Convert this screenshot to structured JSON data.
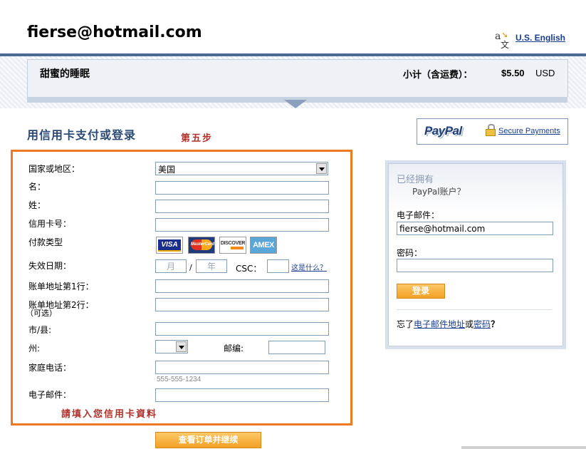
{
  "header": {
    "account_email": "fierse@hotmail.com",
    "language_icon": "translate-icon",
    "language_link": "U.S. English"
  },
  "cart": {
    "item_title": "甜蜜的睡眠",
    "subtotal_label": "小计（含运费）：",
    "amount": "$5.50",
    "currency": "USD"
  },
  "section": {
    "title": "用信用卡支付或登录",
    "step_annotation": "第五步"
  },
  "paypal_badge": {
    "logo_text": "PayPal",
    "lock_icon": "lock-icon",
    "secure_link": "Secure Payments"
  },
  "form": {
    "country_label": "国家或地区：",
    "country_value": "美国",
    "first_name_label": "名：",
    "last_name_label": "姓：",
    "card_number_label": "信用卡号：",
    "payment_type_label": "付款类型",
    "card_types": [
      "VISA",
      "MasterCard",
      "DISCOVER",
      "AMEX"
    ],
    "expiry_label": "失效日期：",
    "month_placeholder": "月",
    "date_separator": "/",
    "year_placeholder": "年",
    "csc_label": "CSC：",
    "csc_help_link": "这是什么？",
    "address1_label": "账单地址第1行：",
    "address2_label": "账单地址第2行：",
    "address2_optional": "（可选）",
    "city_label": "市/县:",
    "state_label": "州:",
    "state_value": "",
    "zip_label": "邮编:",
    "phone_label": "家庭电话：",
    "phone_hint": "555-555-1234",
    "email_label": "电子邮件：",
    "fill_annotation": "請填入您信用卡資料",
    "submit_label": "查看订单并继续"
  },
  "login": {
    "title": "已经拥有",
    "subtitle": "PayPal账户？",
    "email_label": "电子邮件：",
    "email_value": "fierse@hotmail.com",
    "password_label": "密码：",
    "login_button": "登录",
    "forgot_prefix": "忘了",
    "forgot_email_link": "电子邮件地址",
    "forgot_or": "或",
    "forgot_password_link": "密码",
    "forgot_suffix": "？"
  },
  "colors": {
    "header_rule": "#4b6b94",
    "form_frame": "#f07820",
    "annotation_red": "#b0302a",
    "button_orange": "#f4a024",
    "link_blue": "#1a3d8f"
  }
}
